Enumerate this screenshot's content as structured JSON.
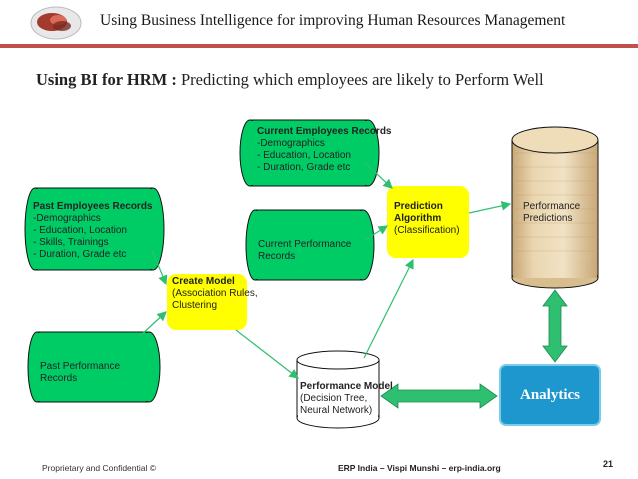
{
  "header": {
    "title": "Using Business Intelligence for improving Human Resources Management"
  },
  "slide": {
    "title_bold": "Using BI for HRM :",
    "title_rest": " Predicting which employees are likely to Perform Well"
  },
  "nodes": {
    "current_records": {
      "title": "Current Employees Records",
      "lines": [
        "-Demographics",
        "- Education, Location",
        "- Duration, Grade etc"
      ]
    },
    "past_records": {
      "title": "Past Employees Records",
      "lines": [
        "-Demographics",
        "- Education, Location",
        "- Skills, Trainings",
        "- Duration, Grade etc"
      ]
    },
    "current_performance": {
      "lines": [
        "Current Performance",
        "Records"
      ]
    },
    "past_performance": {
      "lines": [
        "Past Performance",
        "Records"
      ]
    },
    "create_model": {
      "title": "Create Model",
      "lines": [
        "(Association Rules,",
        "Clustering"
      ]
    },
    "prediction": {
      "lines_bold": [
        "Prediction",
        "Algorithm"
      ],
      "lines": [
        "(Classification)"
      ]
    },
    "performance_predictions": {
      "lines": [
        "Performance",
        "Predictions"
      ]
    },
    "performance_model": {
      "title": "Performance Model",
      "lines": [
        "(Decision Tree,",
        "Neural Network)"
      ]
    },
    "analytics": {
      "label": "Analytics"
    }
  },
  "colors": {
    "cylinder_green": "#00cc66",
    "process_yellow": "#ffff00",
    "analytics_blue": "#1e97ce",
    "connector_green": "#2fbf70",
    "accent_red": "#c0504d"
  },
  "footer": {
    "left": "Proprietary and Confidential ©",
    "center": "ERP India – Vispi Munshi – erp-india.org",
    "page_number": "21"
  }
}
